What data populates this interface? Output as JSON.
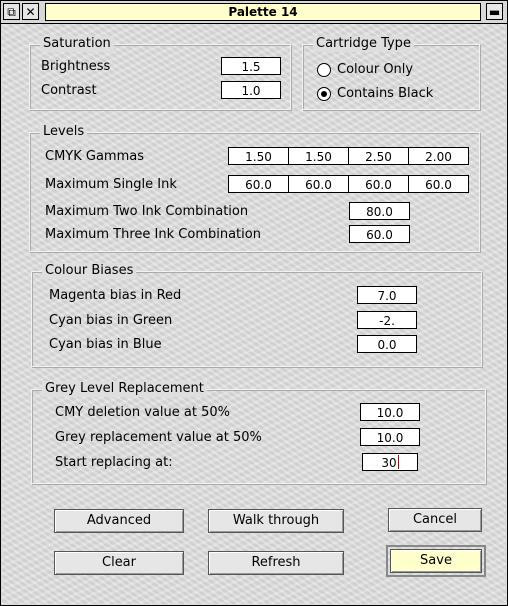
{
  "window": {
    "title": "Palette 14"
  },
  "saturation": {
    "label": "Saturation",
    "brightness_label": "Brightness",
    "brightness_value": "1.5",
    "contrast_label": "Contrast",
    "contrast_value": "1.0"
  },
  "cartridge": {
    "label": "Cartridge Type",
    "options": [
      {
        "label": "Colour Only",
        "selected": false
      },
      {
        "label": "Contains Black",
        "selected": true
      }
    ]
  },
  "levels": {
    "label": "Levels",
    "cmyk_label": "CMYK   Gammas",
    "gammas": [
      "1.50",
      "1.50",
      "2.50",
      "2.00"
    ],
    "single_ink_label": "Maximum Single Ink",
    "single_ink": [
      "60.0",
      "60.0",
      "60.0",
      "60.0"
    ],
    "two_ink_label": "Maximum Two Ink Combination",
    "two_ink_value": "80.0",
    "three_ink_label": "Maximum Three Ink Combination",
    "three_ink_value": "60.0"
  },
  "biases": {
    "label": "Colour Biases",
    "magenta_label": "Magenta bias in Red",
    "magenta_value": "7.0",
    "cyan_green_label": "Cyan bias in Green",
    "cyan_green_value": "-2.",
    "cyan_blue_label": "Cyan bias in Blue",
    "cyan_blue_value": "0.0"
  },
  "grey": {
    "label": "Grey Level Replacement",
    "cmy_label": "CMY deletion value at 50%",
    "cmy_value": "10.0",
    "grey_label": "Grey replacement value at 50%",
    "grey_value": "10.0",
    "start_label": "Start replacing at:",
    "start_value": "30"
  },
  "buttons": {
    "advanced": "Advanced",
    "walk_through": "Walk through",
    "cancel": "Cancel",
    "clear": "Clear",
    "refresh": "Refresh",
    "save": "Save"
  }
}
